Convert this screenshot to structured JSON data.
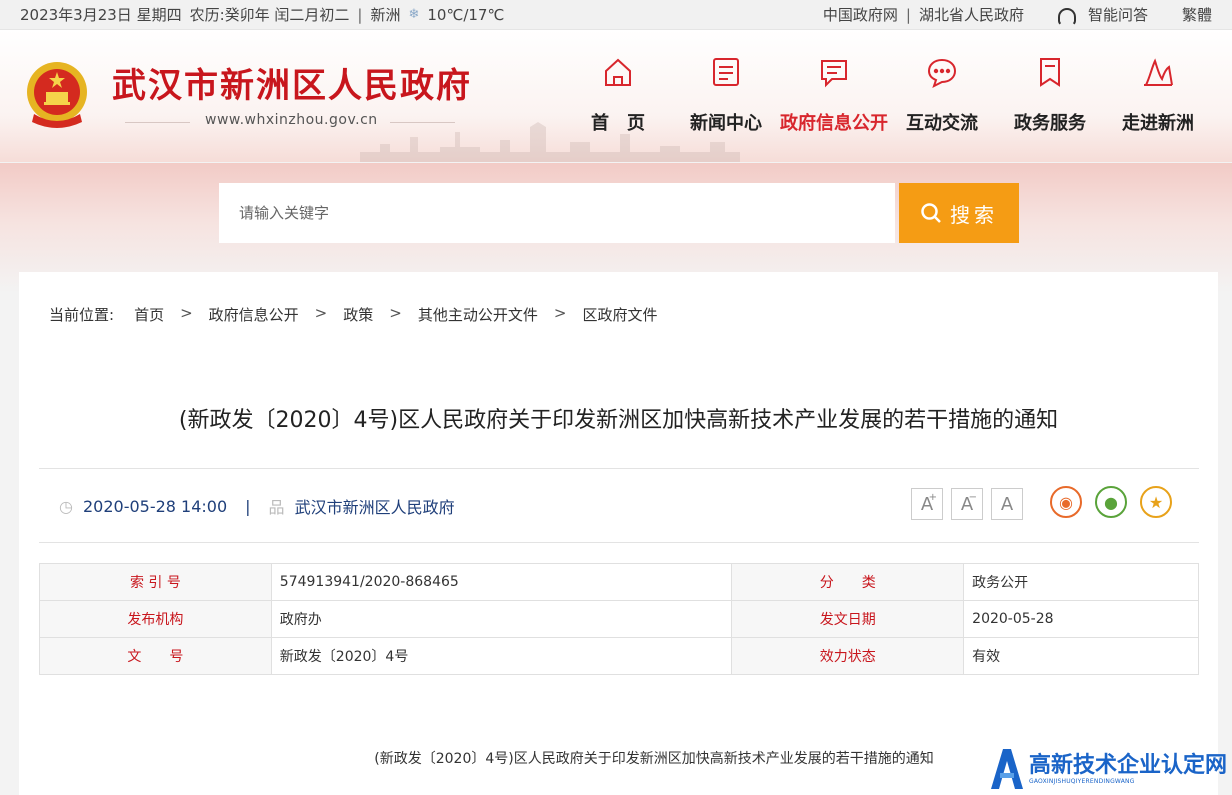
{
  "topbar": {
    "date": "2023年3月23日 星期四",
    "lunar": "农历:癸卯年 闰二月初二",
    "location": "新洲",
    "temperature": "10℃/17℃",
    "links": [
      "中国政府网",
      "湖北省人民政府"
    ],
    "assistant": "智能问答",
    "traditional": "繁體"
  },
  "header": {
    "title": "武汉市新洲区人民政府",
    "url": "www.whxinzhou.gov.cn"
  },
  "nav": [
    {
      "label": "首　页",
      "icon": "home-icon"
    },
    {
      "label": "新闻中心",
      "icon": "news-icon"
    },
    {
      "label": "政府信息公开",
      "icon": "info-public-icon",
      "active": true
    },
    {
      "label": "互动交流",
      "icon": "chat-icon"
    },
    {
      "label": "政务服务",
      "icon": "bookmark-icon"
    },
    {
      "label": "走进新洲",
      "icon": "landmark-icon"
    }
  ],
  "search": {
    "placeholder": "请输入关键字",
    "button": "搜索"
  },
  "breadcrumb": {
    "prefix": "当前位置:",
    "items": [
      "首页",
      "政府信息公开",
      "政策",
      "其他主动公开文件",
      "区政府文件"
    ]
  },
  "article": {
    "title": "(新政发〔2020〕4号)区人民政府关于印发新洲区加快高新技术产业发展的若干措施的通知",
    "datetime": "2020-05-28 14:00",
    "source": "武汉市新洲区人民政府",
    "body_title": "(新政发〔2020〕4号)区人民政府关于印发新洲区加快高新技术产业发展的若干措施的通知"
  },
  "font_buttons": [
    "A",
    "A",
    "A"
  ],
  "info_table": [
    {
      "k1": "索 引 号",
      "v1": "574913941/2020-868465",
      "k2": "分　　类",
      "v2": "政务公开"
    },
    {
      "k1": "发布机构",
      "v1": "政府办",
      "k2": "发文日期",
      "v2": "2020-05-28"
    },
    {
      "k1": "文　　号",
      "v1": "新政发〔2020〕4号",
      "k2": "效力状态",
      "v2": "有效"
    }
  ],
  "watermark": {
    "text": "高新技术企业认定网",
    "sub": "GAOXINJISHUQIYERENDINGWANG"
  },
  "colors": {
    "brand_red": "#c8161d",
    "search_orange": "#f59c14",
    "meta_blue": "#1f3f7a"
  }
}
